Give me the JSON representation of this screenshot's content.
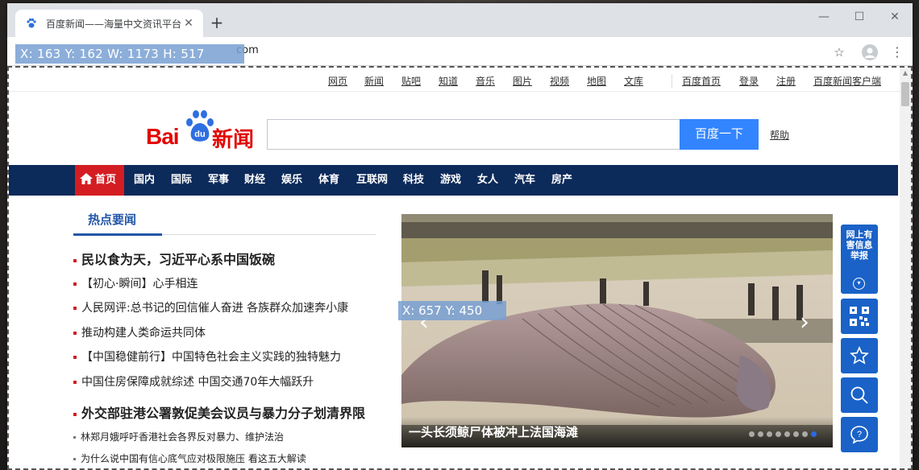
{
  "browser": {
    "tab_title": "百度新闻——海量中文资讯平台",
    "url_suffix": "com",
    "coord_overlay_top": "X: 163 Y: 162 W: 1173 H: 517",
    "coord_overlay_mid": "X: 657 Y: 450"
  },
  "toplinks": [
    "网页",
    "新闻",
    "贴吧",
    "知道",
    "音乐",
    "图片",
    "视频",
    "地图",
    "文库",
    "百度首页",
    "登录",
    "注册",
    "百度新闻客户端"
  ],
  "logo": {
    "bai": "Bai",
    "du": "du",
    "news": "新闻"
  },
  "search": {
    "button": "百度一下",
    "help": "帮助",
    "value": ""
  },
  "nav": {
    "home": "首页",
    "items": [
      "国内",
      "国际",
      "军事",
      "财经",
      "娱乐",
      "体育",
      "互联网",
      "科技",
      "游戏",
      "女人",
      "汽车",
      "房产"
    ]
  },
  "hot_news": {
    "title": "热点要闻",
    "items": [
      "民以食为天，习近平心系中国饭碗",
      "【初心·瞬间】心手相连",
      "人民网评:总书记的回信催人奋进 各族群众加速奔小康",
      "推动构建人类命运共同体",
      "【中国稳健前行】中国特色社会主义实践的独特魅力",
      "中国住房保障成就综述  中国交通70年大幅跃升",
      "外交部驻港公署敦促美会议员与暴力分子划清界限",
      "林郑月娥呼吁香港社会各界反对暴力、维护法治",
      "为什么说中国有信心底气应对极限施压 看这五大解读"
    ]
  },
  "hero": {
    "caption": "一头长须鲸尸体被冲上法国海滩",
    "slides": 8,
    "active_slide": 8
  },
  "side_tools": {
    "report": "网上有害信息举报"
  }
}
